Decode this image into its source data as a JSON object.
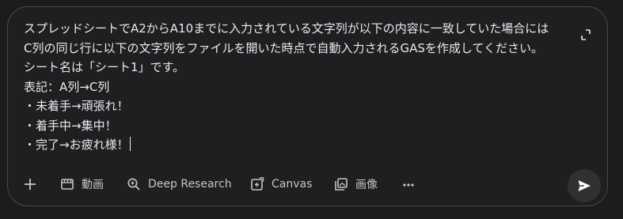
{
  "prompt": {
    "text": "スプレッドシートでA2からA10までに入力されている文字列が以下の内容に一致していた場合には\nC列の同じ行に以下の文字列をファイルを開いた時点で自動入力されるGASを作成してください。\nシート名は「シート1」です。\n表記：A列→C列\n・未着手→頑張れ！\n・着手中→集中！\n・完了→お疲れ様！"
  },
  "toolbar": {
    "add_icon": "plus-icon",
    "video_label": "動画",
    "deep_research_label": "Deep Research",
    "canvas_label": "Canvas",
    "image_label": "画像",
    "more_icon": "more-horizontal-icon"
  },
  "send": {
    "icon": "send-icon"
  },
  "colors": {
    "background": "#1b1c1d",
    "panel": "#1e1f20",
    "border": "#47494c",
    "text": "#e8eaed",
    "icon": "#c4c7c5",
    "send_button": "#2f3133"
  }
}
